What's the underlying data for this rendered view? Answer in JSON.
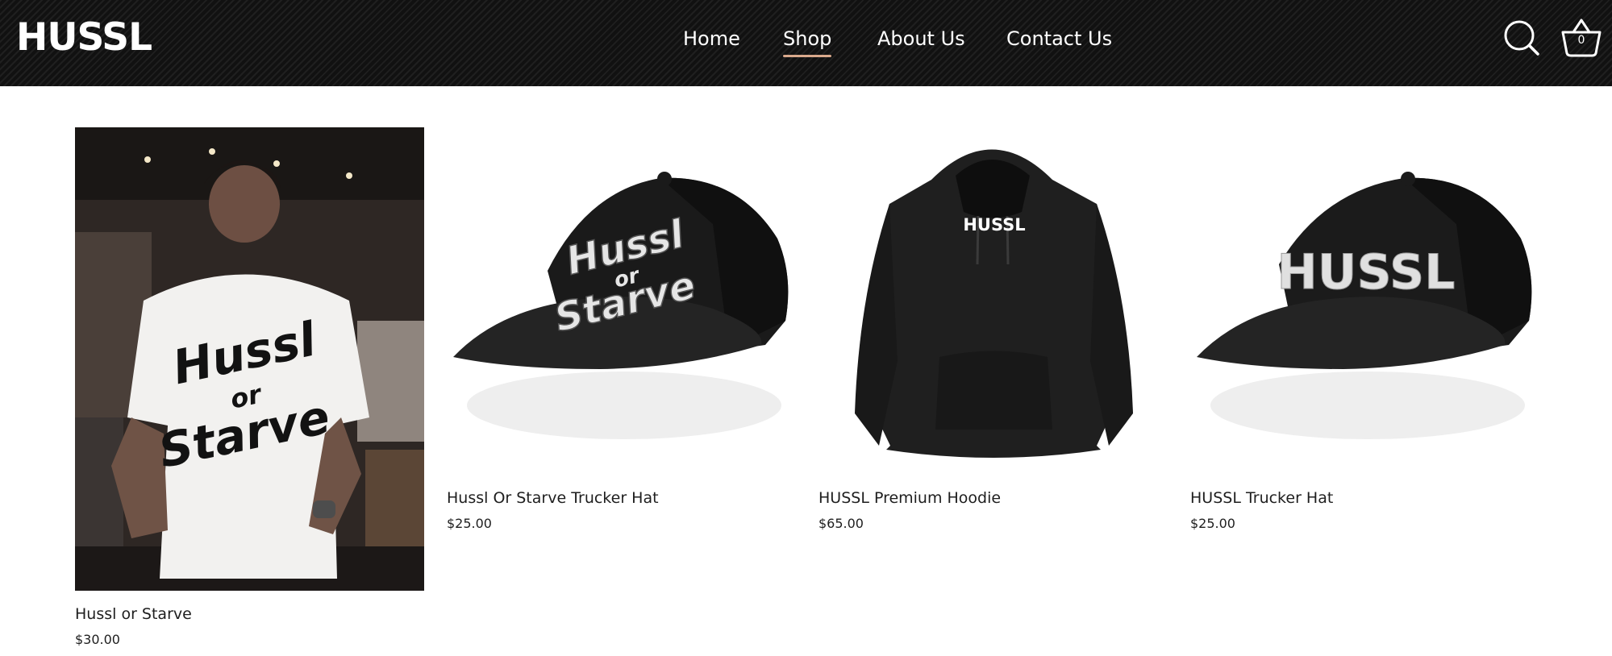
{
  "header": {
    "logo_text": "HUSSL",
    "nav": [
      {
        "label": "Home"
      },
      {
        "label": "Shop"
      },
      {
        "label": "About Us"
      },
      {
        "label": "Contact Us"
      }
    ],
    "active_nav": "Shop",
    "search_icon": "search-icon",
    "cart_icon": "basket-icon",
    "cart_count": "0"
  },
  "products": [
    {
      "title": "Hussl or Starve",
      "price": "$30.00",
      "image_text": "Hussl or Starve"
    },
    {
      "title": "Hussl Or Starve Trucker Hat",
      "price": "$25.00",
      "image_text": "Hussl or Starve"
    },
    {
      "title": "HUSSL Premium Hoodie",
      "price": "$65.00",
      "image_text": "HUSSL"
    },
    {
      "title": "HUSSL Trucker Hat",
      "price": "$25.00",
      "image_text": "HUSSL"
    }
  ],
  "colors": {
    "header_bg": "#161616",
    "nav_underline": "#d9a98c",
    "text": "#1e1e1e"
  }
}
